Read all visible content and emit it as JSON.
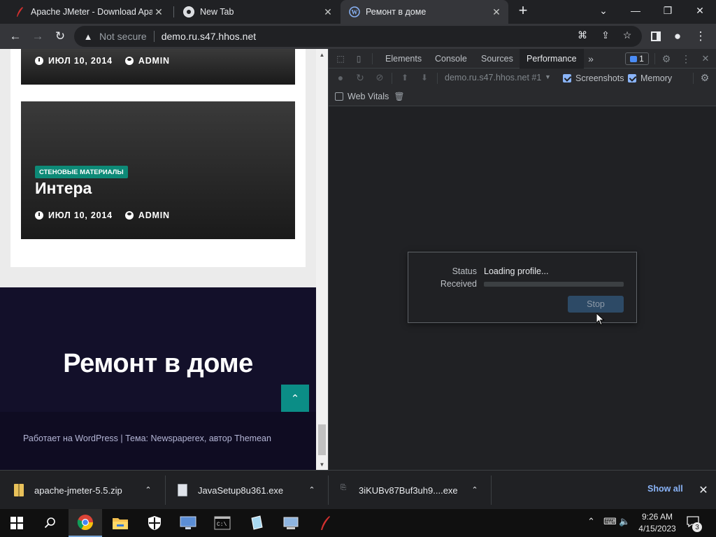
{
  "browser": {
    "tabs": [
      {
        "title": "Apache JMeter - Download Apac",
        "icon": "feather-icon",
        "active": false
      },
      {
        "title": "New Tab",
        "icon": "chrome-icon",
        "active": false
      },
      {
        "title": "Ремонт в доме",
        "icon": "wordpress-icon",
        "active": true
      }
    ],
    "new_tab_symbol": "+",
    "address": {
      "security_label": "Not secure",
      "url": "demo.ru.s47.hhos.net"
    }
  },
  "page": {
    "post_top": {
      "date": "ИЮЛ 10, 2014",
      "author": "ADMIN"
    },
    "post_main": {
      "category": "СТЕНОВЫЕ МАТЕРИАЛЫ",
      "title": "Интера",
      "date": "ИЮЛ 10, 2014",
      "author": "ADMIN"
    },
    "footer": {
      "site_title": "Ремонт в доме",
      "credit": "Работает на WordPress | Тема: Newspaperex, автор Themean"
    }
  },
  "devtools": {
    "tabs": [
      "Elements",
      "Console",
      "Sources",
      "Performance"
    ],
    "active_tab": "Performance",
    "issues_count": "1",
    "target": "demo.ru.s47.hhos.net #1",
    "checkboxes": [
      {
        "label": "Screenshots",
        "checked": true
      },
      {
        "label": "Memory",
        "checked": true
      },
      {
        "label": "Web Vitals",
        "checked": false
      }
    ],
    "status_dialog": {
      "status_label": "Status",
      "status_value": "Loading profile...",
      "received_label": "Received",
      "received_progress": 0,
      "stop_label": "Stop"
    }
  },
  "downloads": {
    "items": [
      {
        "name": "apache-jmeter-5.5.zip",
        "icon": "zip-file-icon"
      },
      {
        "name": "JavaSetup8u361.exe",
        "icon": "installer-icon"
      },
      {
        "name": "3iKUBv87Buf3uh9....exe",
        "icon": "unknown-file-icon"
      }
    ],
    "show_all": "Show all"
  },
  "taskbar": {
    "time": "9:26 AM",
    "date": "4/15/2023",
    "notifications": "3"
  },
  "colors": {
    "accent_teal": "#0d8a77",
    "devtools_blue": "#8ab4f8",
    "footer_navy": "#13102a"
  }
}
